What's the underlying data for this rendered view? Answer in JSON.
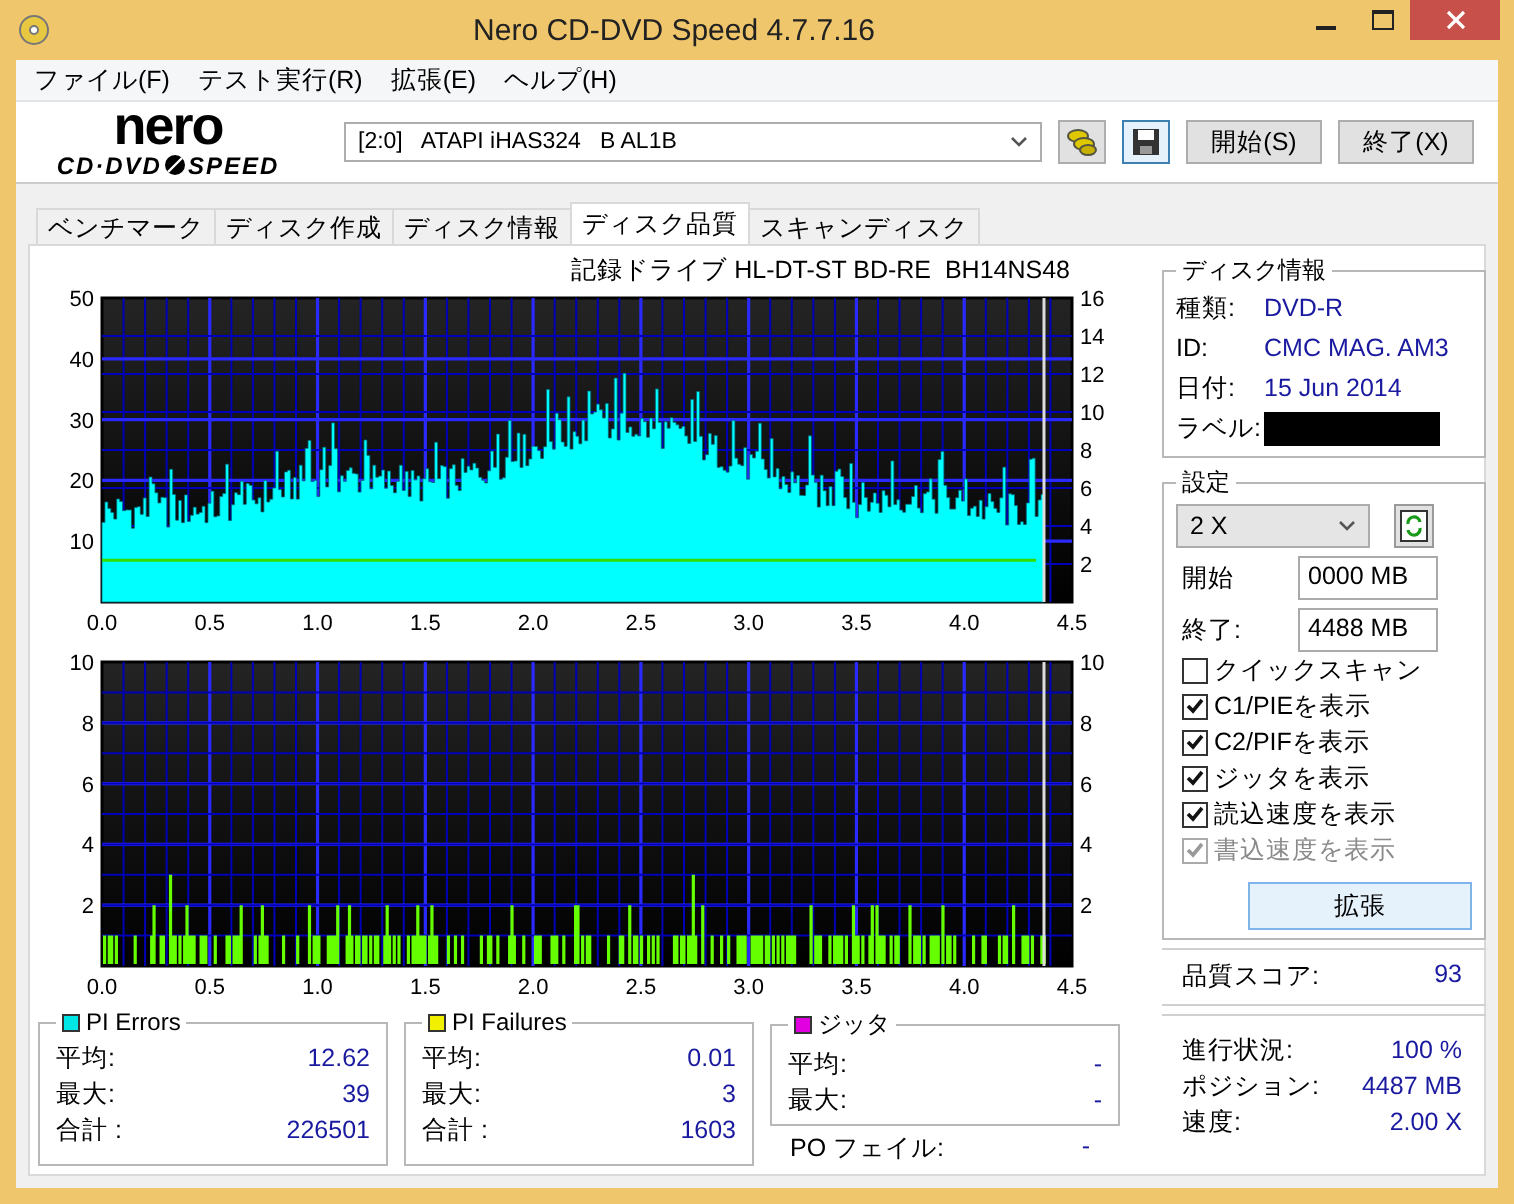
{
  "window": {
    "title": "Nero CD-DVD Speed 4.7.7.16"
  },
  "menu": [
    "ファイル(F)",
    "テスト実行(R)",
    "拡張(E)",
    "ヘルプ(H)"
  ],
  "logo": {
    "brand": "nero",
    "line_1": "CD·DVD",
    "line_2": "SPEED"
  },
  "toolbar": {
    "drive": "[2:0]   ATAPI iHAS324   B AL1B",
    "buttons": [
      "開始(S)",
      "終了(X)"
    ]
  },
  "tabs": [
    {
      "label": "ベンチマーク",
      "selected": false
    },
    {
      "label": "ディスク作成",
      "selected": false
    },
    {
      "label": "ディスク情報",
      "selected": false
    },
    {
      "label": "ディスク品質",
      "selected": true
    },
    {
      "label": "スキャンディスク",
      "selected": false
    }
  ],
  "chart_title": "記録ドライブ HL-DT-ST BD-RE  BH14NS48",
  "charts": [
    {
      "kind": "errors",
      "y_labels": [
        "50",
        "40",
        "30",
        "20",
        "10"
      ],
      "y2_labels": [
        "16",
        "14",
        "12",
        "10",
        "8",
        "6",
        "4",
        "2"
      ],
      "x_labels": [
        "0.0",
        "0.5",
        "1.0",
        "1.5",
        "2.0",
        "2.5",
        "3.0",
        "3.5",
        "4.0",
        "4.5"
      ]
    },
    {
      "kind": "failures",
      "y_labels": [
        "10",
        "8",
        "6",
        "4",
        "2"
      ],
      "y2_labels": [
        "10",
        "8",
        "6",
        "4",
        "2"
      ],
      "x_labels": [
        "0.0",
        "0.5",
        "1.0",
        "1.5",
        "2.0",
        "2.5",
        "3.0",
        "3.5",
        "4.0",
        "4.5"
      ]
    }
  ],
  "stat_groups": [
    {
      "title": "PI Errors",
      "color": "#00e5e5",
      "rows": [
        {
          "label": "平均:",
          "value": "12.62"
        },
        {
          "label": "最大:",
          "value": "39"
        },
        {
          "label": "合計 :",
          "value": "226501"
        }
      ]
    },
    {
      "title": "PI Failures",
      "color": "#f0f000",
      "rows": [
        {
          "label": "平均:",
          "value": "0.01"
        },
        {
          "label": "最大:",
          "value": "3"
        },
        {
          "label": "合計 :",
          "value": "1603"
        }
      ]
    },
    {
      "title": "ジッタ",
      "color": "#e000e0",
      "rows": [
        {
          "label": "平均:",
          "value": "-"
        },
        {
          "label": "最大:",
          "value": "-"
        }
      ]
    }
  ],
  "po_failures": {
    "label": "PO フェイル:",
    "value": "-"
  },
  "disc_info": {
    "title": "ディスク情報",
    "rows": [
      {
        "kind": "text",
        "label": "種類:",
        "value": "DVD-R"
      },
      {
        "kind": "text",
        "label": "ID:",
        "value": "CMC MAG. AM3"
      },
      {
        "kind": "text",
        "label": "日付:",
        "value": "15 Jun 2014"
      },
      {
        "kind": "redacted",
        "label": "ラベル:"
      }
    ]
  },
  "settings": {
    "title": "設定",
    "speed": "2 X",
    "start": {
      "label": "開始",
      "value": "0000 MB"
    },
    "end": {
      "label": "終了:",
      "value": "4488 MB"
    },
    "options": [
      {
        "label": "クイックスキャン",
        "checked": false,
        "disabled": false
      },
      {
        "label": "C1/PIEを表示",
        "checked": true,
        "disabled": false
      },
      {
        "label": "C2/PIFを表示",
        "checked": true,
        "disabled": false
      },
      {
        "label": "ジッタを表示",
        "checked": true,
        "disabled": false
      },
      {
        "label": "読込速度を表示",
        "checked": true,
        "disabled": false
      },
      {
        "label": "書込速度を表示",
        "checked": true,
        "disabled": true
      }
    ],
    "button": "拡張"
  },
  "quality": {
    "label": "品質スコア:",
    "value": "93"
  },
  "progress": [
    {
      "label": "進行状況:",
      "value": "100 %"
    },
    {
      "label": "ポジション:",
      "value": "4487 MB"
    },
    {
      "label": "速度:",
      "value": "2.00 X"
    }
  ]
}
